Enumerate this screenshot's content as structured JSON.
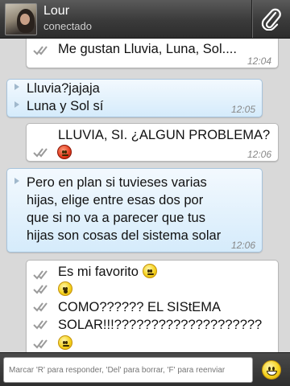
{
  "header": {
    "contact_name": "Lour",
    "contact_status": "conectado",
    "attach_icon": "paperclip-icon"
  },
  "messages": [
    {
      "dir": "out",
      "lines": [
        "Me gustan Lluvia, Luna, Sol...."
      ],
      "time": "12:04"
    },
    {
      "dir": "in",
      "lines": [
        "Lluvia?jajaja",
        "Luna y Sol sí"
      ],
      "time": "12:05"
    },
    {
      "dir": "out",
      "lines": [
        "LLUVIA, SI. ¿ALGUN PROBLEMA?"
      ],
      "emoji": "angry-face",
      "time": "12:06"
    },
    {
      "dir": "in",
      "lines": [
        "Pero en plan si tuvieses varias",
        "hijas, elige entre esas dos por",
        "que si no va a parecer que tus",
        "hijas son cosas del sistema solar"
      ],
      "time": "12:06"
    },
    {
      "dir": "out",
      "lines": [
        "Es mi favorito",
        "",
        "COMO?????? EL SIStEMA",
        "SOLAR!!!????????????????????",
        ""
      ],
      "emojis": [
        "smiling-face",
        "surprised-face",
        "neutral-face"
      ]
    }
  ],
  "composer": {
    "placeholder": "Marcar 'R' para responder, 'Del' para borrar, 'F' para reenviar",
    "emoji_button_icon": "grinning-face-icon"
  },
  "colors": {
    "header_bg": "#3a3a3a",
    "incoming_bubble": "#d5ebfb",
    "outgoing_bubble": "#ffffff",
    "chat_bg": "#d9d9d9"
  }
}
